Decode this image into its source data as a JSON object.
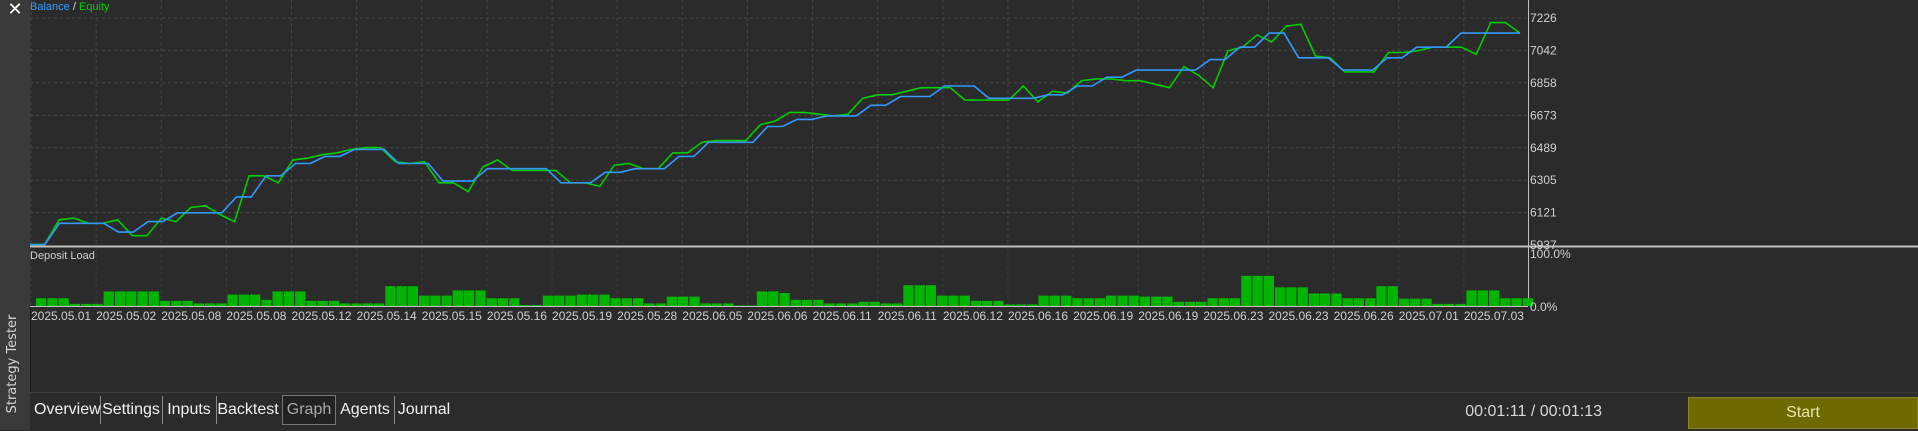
{
  "window": {
    "side_title": "Strategy Tester",
    "close_glyph": "✕"
  },
  "legend": {
    "balance": "Balance",
    "separator": " / ",
    "equity": "Equity"
  },
  "colors": {
    "balance": "#3399ff",
    "equity": "#00cc00",
    "bars": "#00b400",
    "accent": "#6e6a00"
  },
  "deposit": {
    "title": "Deposit Load",
    "max_label": "100.0%",
    "min_label": "0.0%"
  },
  "tabs": [
    "Overview",
    "Settings",
    "Inputs",
    "Backtest",
    "Graph",
    "Agents",
    "Journal"
  ],
  "active_tab": "Graph",
  "status": {
    "timer": "00:01:11 / 00:01:13"
  },
  "start_label": "Start",
  "chart_data": [
    {
      "type": "line",
      "title": "",
      "x_categories": [
        "2025.05.01",
        "2025.05.02",
        "2025.05.08",
        "2025.05.08",
        "2025.05.12",
        "2025.05.14",
        "2025.05.15",
        "2025.05.16",
        "2025.05.19",
        "2025.05.28",
        "2025.06.05",
        "2025.06.06",
        "2025.06.11",
        "2025.06.11",
        "2025.06.12",
        "2025.06.16",
        "2025.06.19",
        "2025.06.19",
        "2025.06.23",
        "2025.06.23",
        "2025.06.26",
        "2025.07.01",
        "2025.07.03"
      ],
      "y_ticks": [
        7226,
        7042,
        6858,
        6673,
        6489,
        6305,
        6121,
        5937
      ],
      "ylim": [
        5937,
        7226
      ],
      "grid": true,
      "legend": "top-left",
      "series": [
        {
          "name": "Balance",
          "values": [
            5940,
            5940,
            6060,
            6060,
            6060,
            6060,
            6010,
            6010,
            6070,
            6070,
            6120,
            6120,
            6120,
            6120,
            6210,
            6210,
            6330,
            6330,
            6400,
            6400,
            6440,
            6440,
            6480,
            6480,
            6480,
            6400,
            6400,
            6400,
            6300,
            6300,
            6300,
            6370,
            6370,
            6370,
            6370,
            6370,
            6290,
            6290,
            6290,
            6350,
            6350,
            6370,
            6370,
            6370,
            6440,
            6440,
            6520,
            6520,
            6520,
            6520,
            6610,
            6610,
            6650,
            6650,
            6670,
            6670,
            6670,
            6730,
            6730,
            6780,
            6780,
            6780,
            6840,
            6840,
            6840,
            6770,
            6770,
            6770,
            6770,
            6790,
            6790,
            6840,
            6840,
            6890,
            6890,
            6930,
            6930,
            6930,
            6930,
            6930,
            6990,
            6990,
            7060,
            7060,
            7140,
            7140,
            7000,
            7000,
            7000,
            6930,
            6930,
            6930,
            7000,
            7000,
            7060,
            7060,
            7060,
            7140,
            7140,
            7140,
            7140,
            7140
          ]
        },
        {
          "name": "Equity",
          "values": [
            5940,
            5940,
            6080,
            6090,
            6060,
            6060,
            6080,
            5990,
            5990,
            6090,
            6070,
            6150,
            6160,
            6110,
            6070,
            6330,
            6330,
            6290,
            6420,
            6430,
            6450,
            6460,
            6480,
            6490,
            6490,
            6410,
            6400,
            6410,
            6290,
            6290,
            6240,
            6380,
            6420,
            6360,
            6360,
            6360,
            6360,
            6290,
            6290,
            6270,
            6390,
            6400,
            6370,
            6370,
            6460,
            6460,
            6520,
            6530,
            6530,
            6530,
            6620,
            6640,
            6690,
            6690,
            6680,
            6670,
            6680,
            6770,
            6790,
            6790,
            6810,
            6830,
            6830,
            6830,
            6760,
            6760,
            6760,
            6760,
            6840,
            6750,
            6810,
            6800,
            6870,
            6880,
            6880,
            6870,
            6870,
            6850,
            6830,
            6950,
            6900,
            6830,
            7040,
            7060,
            7130,
            7090,
            7180,
            7190,
            7010,
            7000,
            6920,
            6920,
            6920,
            7030,
            7030,
            7040,
            7060,
            7060,
            7060,
            7020,
            7200,
            7200,
            7140
          ]
        }
      ]
    },
    {
      "type": "bar",
      "title": "Deposit Load",
      "ylim": [
        0,
        100
      ],
      "y_ticks": [
        "100.0%",
        "0.0%"
      ],
      "values": [
        15,
        15,
        15,
        4,
        4,
        4,
        28,
        28,
        28,
        28,
        28,
        10,
        10,
        10,
        5,
        5,
        5,
        22,
        22,
        22,
        12,
        28,
        28,
        28,
        10,
        10,
        10,
        5,
        5,
        5,
        5,
        38,
        38,
        38,
        20,
        20,
        20,
        30,
        30,
        30,
        15,
        15,
        15,
        2,
        2,
        20,
        20,
        20,
        22,
        22,
        22,
        15,
        15,
        15,
        5,
        5,
        18,
        18,
        18,
        5,
        5,
        5,
        1,
        1,
        28,
        28,
        25,
        12,
        12,
        12,
        5,
        5,
        5,
        8,
        8,
        5,
        5,
        40,
        40,
        40,
        20,
        20,
        20,
        10,
        10,
        10,
        3,
        3,
        3,
        20,
        20,
        20,
        15,
        15,
        15,
        20,
        20,
        20,
        18,
        18,
        18,
        8,
        8,
        8,
        15,
        15,
        15,
        58,
        58,
        58,
        36,
        36,
        36,
        24,
        24,
        24,
        15,
        15,
        15,
        38,
        38,
        14,
        14,
        14,
        4,
        4,
        4,
        30,
        30,
        30,
        15,
        15,
        15
      ]
    }
  ]
}
